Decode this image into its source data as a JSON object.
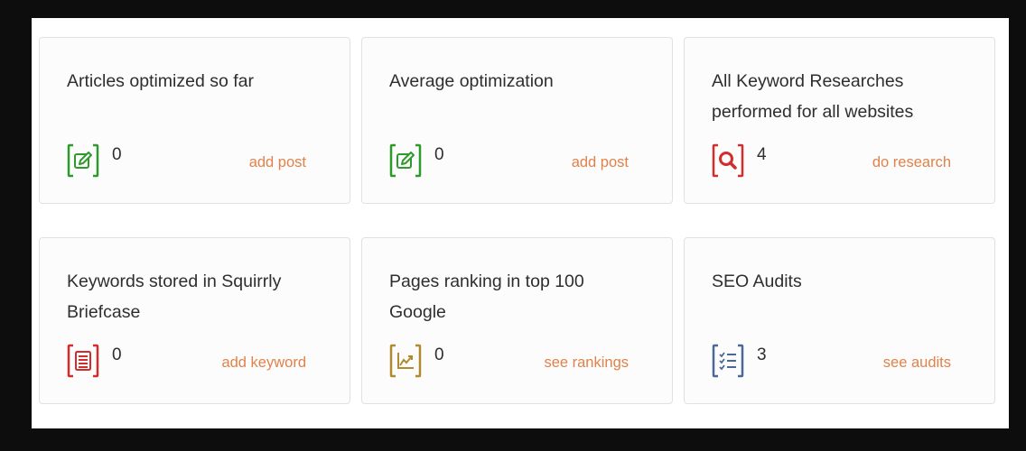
{
  "colors": {
    "green": "#2e9a2a",
    "red": "#d42b2b",
    "gold": "#b08a2e",
    "blue": "#4a6898",
    "link": "#e0824a"
  },
  "cards": [
    {
      "title": "Articles optimized so far",
      "count": "0",
      "link": "add post",
      "icon": "edit-icon"
    },
    {
      "title": "Average optimization",
      "count": "0",
      "link": "add post",
      "icon": "edit-icon"
    },
    {
      "title": "All Keyword Researches performed for all websites",
      "count": "4",
      "link": "do research",
      "icon": "search-icon"
    },
    {
      "title": "Keywords stored in Squirrly Briefcase",
      "count": "0",
      "link": "add keyword",
      "icon": "briefcase-icon"
    },
    {
      "title": "Pages ranking in top 100 Google",
      "count": "0",
      "link": "see rankings",
      "icon": "chart-icon"
    },
    {
      "title": "SEO Audits",
      "count": "3",
      "link": "see audits",
      "icon": "checklist-icon"
    }
  ]
}
